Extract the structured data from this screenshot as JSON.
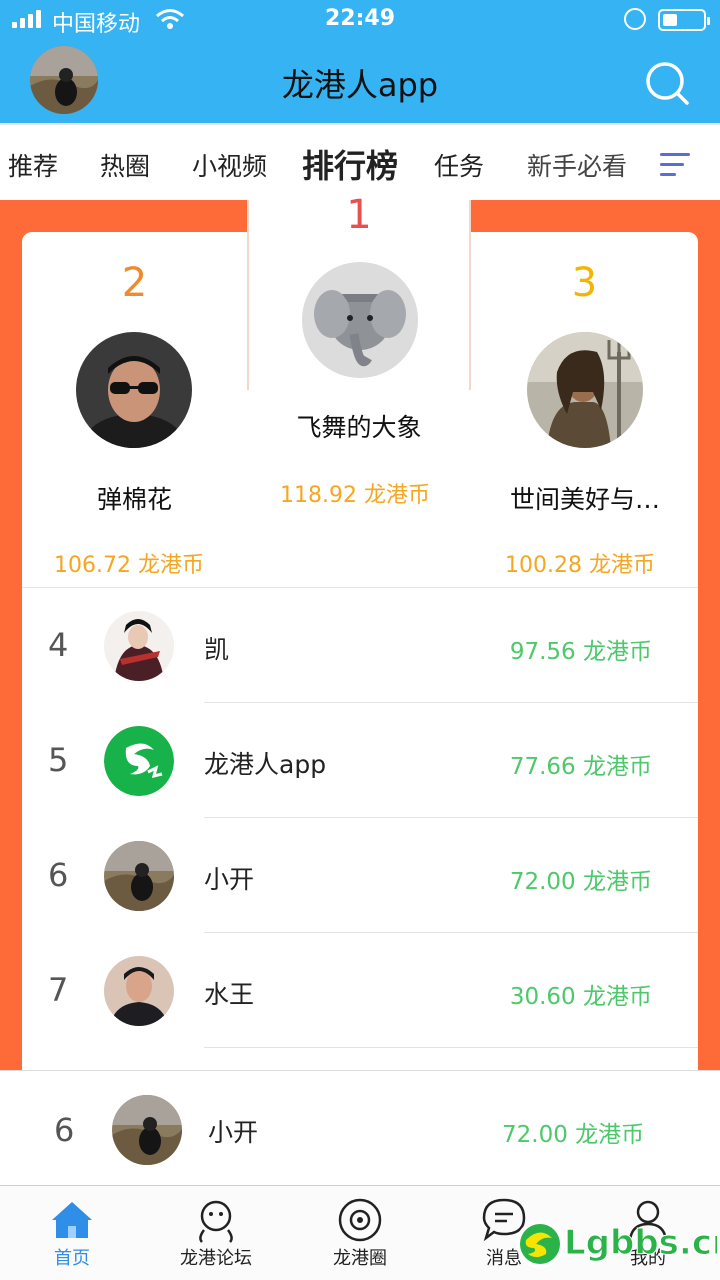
{
  "status_bar": {
    "carrier": "中国移动",
    "time": "22:49"
  },
  "header": {
    "title": "龙港人app"
  },
  "tabs": [
    {
      "label": "推荐"
    },
    {
      "label": "热圈"
    },
    {
      "label": "小视频"
    },
    {
      "label": "排行榜",
      "active": true
    },
    {
      "label": "任务"
    },
    {
      "label": "新手必看"
    }
  ],
  "podium": {
    "first": {
      "rank": "1",
      "name": "飞舞的大象",
      "coins": "118.92  龙港币"
    },
    "second": {
      "rank": "2",
      "name": "弹棉花",
      "coins": "106.72  龙港币"
    },
    "third": {
      "rank": "3",
      "name": "世间美好与…",
      "coins": "100.28  龙港币"
    }
  },
  "ranking": [
    {
      "rank": "4",
      "name": "凯",
      "coins": "97.56 龙港币"
    },
    {
      "rank": "5",
      "name": "龙港人app",
      "coins": "77.66 龙港币"
    },
    {
      "rank": "6",
      "name": "小开",
      "coins": "72.00 龙港币"
    },
    {
      "rank": "7",
      "name": "水王",
      "coins": "30.60 龙港币"
    }
  ],
  "my_rank": {
    "rank": "6",
    "name": "小开",
    "coins": "72.00 龙港币"
  },
  "bottom_nav": [
    {
      "label": "首页",
      "icon": "home-icon",
      "active": true
    },
    {
      "label": "龙港论坛",
      "icon": "forum-icon"
    },
    {
      "label": "龙港圈",
      "icon": "circle-icon"
    },
    {
      "label": "消息",
      "icon": "message-icon"
    },
    {
      "label": "我的",
      "icon": "profile-icon"
    }
  ],
  "watermark": {
    "text": "Lgbbs.cn"
  },
  "colors": {
    "header_blue": "#36b3f2",
    "ranking_orange": "#ff6a39",
    "rank2_orange": "#f08a2c",
    "rank1_red": "#e85050",
    "rank3_yellow": "#f5b400",
    "coin_gold": "#f5a623",
    "coin_green": "#4dc86b",
    "nav_active_blue": "#2e8ee8"
  }
}
